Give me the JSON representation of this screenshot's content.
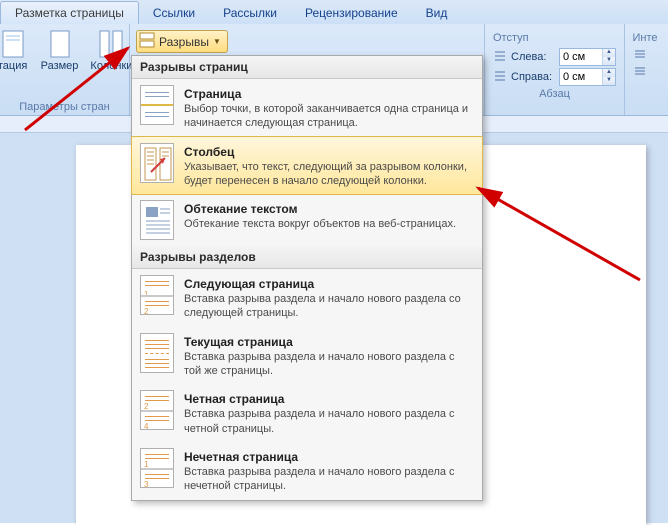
{
  "tabs": {
    "layout": "Разметка страницы",
    "links": "Ссылки",
    "mailings": "Рассылки",
    "review": "Рецензирование",
    "view": "Вид"
  },
  "toolbar": {
    "orientation": "тация",
    "size": "Размер",
    "columns": "Колонки",
    "breaks": "Разрывы",
    "group_page_setup": "Параметры стран"
  },
  "indent": {
    "title": "Отступ",
    "left": "Слева:",
    "right": "Справа:",
    "value_left": "0 см",
    "value_right": "0 см",
    "group_paragraph": "Абзац"
  },
  "right_edge": {
    "spacing": "Инте"
  },
  "dropdown": {
    "section1": "Разрывы страниц",
    "items1": [
      {
        "title": "Страница",
        "desc": "Выбор точки, в которой заканчивается одна страница и начинается следующая страница."
      },
      {
        "title": "Столбец",
        "desc": "Указывает, что текст, следующий за разрывом колонки, будет перенесен в начало следующей колонки."
      },
      {
        "title": "Обтекание текстом",
        "desc": "Обтекание текста вокруг объектов на веб-страницах."
      }
    ],
    "section2": "Разрывы разделов",
    "items2": [
      {
        "title": "Следующая страница",
        "desc": "Вставка разрыва раздела и начало нового раздела со следующей страницы."
      },
      {
        "title": "Текущая страница",
        "desc": "Вставка разрыва раздела и начало нового раздела с той же страницы."
      },
      {
        "title": "Четная страница",
        "desc": "Вставка разрыва раздела и начало нового раздела с четной страницы."
      },
      {
        "title": "Нечетная страница",
        "desc": "Вставка разрыва раздела и начало нового раздела с нечетной страницы."
      }
    ]
  }
}
